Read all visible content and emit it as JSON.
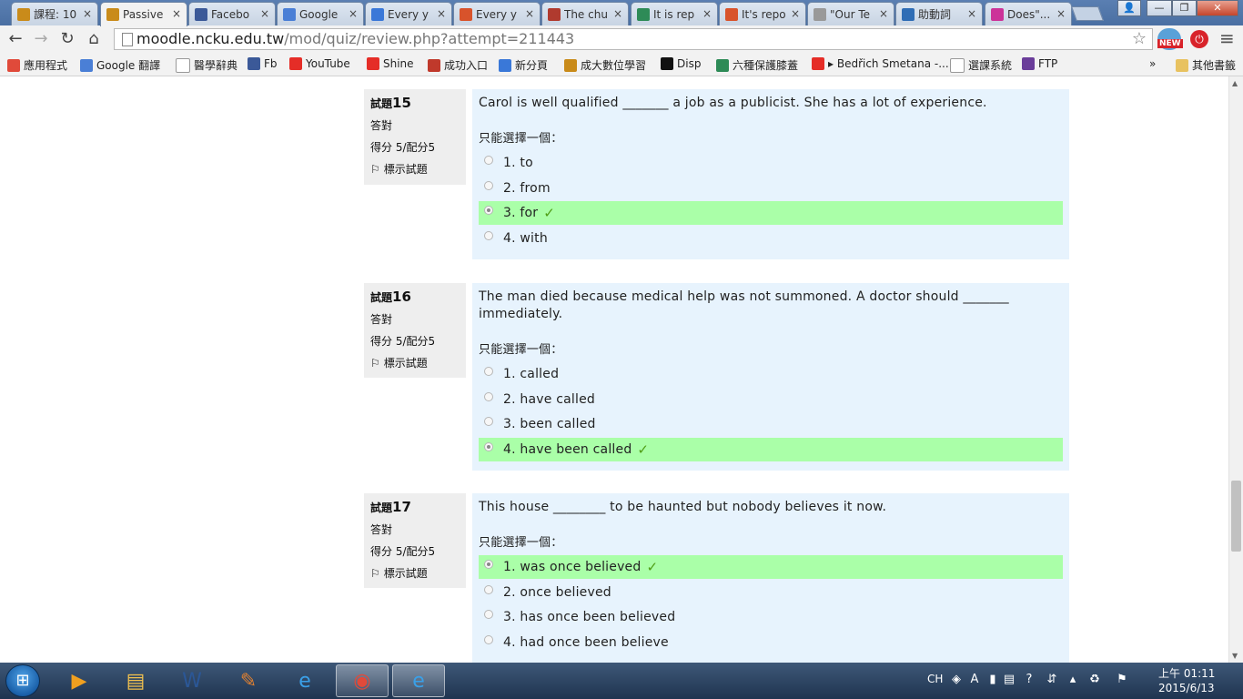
{
  "browser": {
    "tabs": [
      {
        "title": "課程: 10",
        "icon_color": "#c98b1a",
        "icon": "moodle-icon"
      },
      {
        "title": "Passive",
        "icon_color": "#c98b1a",
        "icon": "moodle-icon",
        "active": true
      },
      {
        "title": "Facebo",
        "icon_color": "#3b5998",
        "icon": "facebook-icon"
      },
      {
        "title": "Google",
        "icon_color": "#4a7fd6",
        "icon": "google-translate-icon"
      },
      {
        "title": "Every y",
        "icon_color": "#3a78d8",
        "icon": "google-search-icon"
      },
      {
        "title": "Every y",
        "icon_color": "#d8532b",
        "icon": "grammar-site-icon"
      },
      {
        "title": "The chu",
        "icon_color": "#b03a2e",
        "icon": "crab-icon"
      },
      {
        "title": "It is rep",
        "icon_color": "#2e8b57",
        "icon": "leaf-icon"
      },
      {
        "title": "It's repo",
        "icon_color": "#d8532b",
        "icon": "grammar-site-icon"
      },
      {
        "title": "\"Our Te",
        "icon_color": "#999999",
        "icon": "page-icon"
      },
      {
        "title": "助動詞",
        "icon_color": "#2f6db5",
        "icon": "person-icon"
      },
      {
        "title": "Does\"...",
        "icon_color": "#cc3399",
        "icon": "speech-bubble-icon"
      }
    ],
    "close_glyph": "×",
    "window_buttons": {
      "user": "👤",
      "minimize": "—",
      "maximize": "❐",
      "close": "✕"
    },
    "url_host": "moodle.ncku.edu.tw",
    "url_path": "/mod/quiz/review.php?attempt=211443",
    "star": "☆",
    "menu": "≡",
    "bookmarks": [
      {
        "label": "應用程式",
        "icon_color": "#e04a3a",
        "icon": "apps-icon"
      },
      {
        "label": "Google 翻譯",
        "icon_color": "#4a7fd6",
        "icon": "google-translate-icon"
      },
      {
        "label": "醫學辭典",
        "icon_color": "#ffffff",
        "icon": "page-icon"
      },
      {
        "label": "Fb",
        "icon_color": "#3b5998",
        "icon": "facebook-icon"
      },
      {
        "label": "YouTube",
        "icon_color": "#e52d27",
        "icon": "youtube-icon"
      },
      {
        "label": "Shine",
        "icon_color": "#e52d27",
        "icon": "youtube-icon"
      },
      {
        "label": "成功入口",
        "icon_color": "#c0392b",
        "icon": "ncku-icon"
      },
      {
        "label": "新分頁",
        "icon_color": "#3a78d8",
        "icon": "google-search-icon"
      },
      {
        "label": "成大數位學習",
        "icon_color": "#c98b1a",
        "icon": "moodle-icon"
      },
      {
        "label": "Disp",
        "icon_color": "#111111",
        "icon": "disp-icon"
      },
      {
        "label": "六種保護膝蓋",
        "icon_color": "#2e8b57",
        "icon": "bookmark-icon"
      },
      {
        "label": "▸ Bedřich Smetana -...",
        "icon_color": "#e52d27",
        "icon": "youtube-icon"
      },
      {
        "label": "選課系統",
        "icon_color": "#ffffff",
        "icon": "page-icon"
      },
      {
        "label": "FTP",
        "icon_color": "#6a3d9a",
        "icon": "ftp-icon"
      }
    ],
    "bookmarks_overflow": "»",
    "other_bookmarks": "其他書籤"
  },
  "quiz": {
    "questions": [
      {
        "label": "試題",
        "number": "15",
        "state": "答對",
        "grade": "得分 5/配分5",
        "flag_label": "標示試題",
        "text": "Carol is well qualified _______ a job as a publicist. She has a lot of experience.",
        "prompt": "只能選擇一個：",
        "options": [
          {
            "text": "1. to",
            "selected": false,
            "correct": false
          },
          {
            "text": "2. from",
            "selected": false,
            "correct": false
          },
          {
            "text": "3. for",
            "selected": true,
            "correct": true
          },
          {
            "text": "4. with",
            "selected": false,
            "correct": false
          }
        ]
      },
      {
        "label": "試題",
        "number": "16",
        "state": "答對",
        "grade": "得分 5/配分5",
        "flag_label": "標示試題",
        "text": "The man died because medical help was not summoned.   A doctor should _______ immediately.",
        "prompt": "只能選擇一個：",
        "options": [
          {
            "text": "1. called",
            "selected": false,
            "correct": false
          },
          {
            "text": "2. have called",
            "selected": false,
            "correct": false
          },
          {
            "text": "3. been called",
            "selected": false,
            "correct": false
          },
          {
            "text": "4. have been called",
            "selected": true,
            "correct": true
          }
        ]
      },
      {
        "label": "試題",
        "number": "17",
        "state": "答對",
        "grade": "得分 5/配分5",
        "flag_label": "標示試題",
        "text": "This house ________ to be haunted but nobody believes it now.",
        "prompt": "只能選擇一個：",
        "options": [
          {
            "text": "1. was once believed",
            "selected": true,
            "correct": true
          },
          {
            "text": "2. once believed",
            "selected": false,
            "correct": false
          },
          {
            "text": "3. has once been believed",
            "selected": false,
            "correct": false
          },
          {
            "text": "4. had once been believe",
            "selected": false,
            "correct": false
          }
        ]
      }
    ],
    "correct_mark": "✓",
    "flag_icon": "⚐"
  },
  "taskbar": {
    "start_icon": "windows-start-icon",
    "items": [
      {
        "name": "media-player-icon",
        "glyph": "▶",
        "color": "#f0a020"
      },
      {
        "name": "file-explorer-icon",
        "glyph": "▤",
        "color": "#f2c14e"
      },
      {
        "name": "word-icon",
        "glyph": "W",
        "color": "#2b5797"
      },
      {
        "name": "paint-icon",
        "glyph": "✎",
        "color": "#e08030"
      },
      {
        "name": "internet-explorer-icon",
        "glyph": "e",
        "color": "#3aa0e8"
      },
      {
        "name": "chrome-icon",
        "glyph": "◉",
        "color": "#e04a3a",
        "open": true
      },
      {
        "name": "internet-explorer-icon",
        "glyph": "e",
        "color": "#3aa0e8",
        "open": true
      }
    ],
    "ime": "CH",
    "tray_icons": [
      "language-bar-icon",
      "input-mode-icon",
      "keyboard-icon",
      "toolbar-icon",
      "help-icon",
      "network-icon",
      "show-hidden-icons-icon",
      "recycle-icon",
      "flag-icon"
    ],
    "clock_time": "上午 01:11",
    "clock_date": "2015/6/13"
  }
}
